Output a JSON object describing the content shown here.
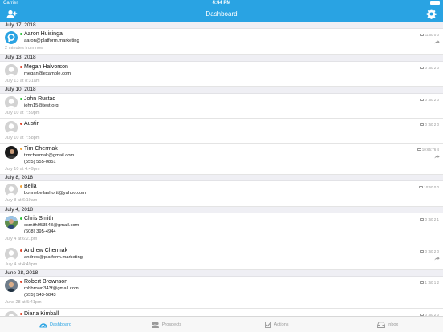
{
  "status_bar": {
    "carrier": "Carrier",
    "time": "4:44 PM",
    "battery_level": 1.0
  },
  "nav": {
    "title": "Dashboard",
    "add_icon": "add-contact-icon",
    "settings_icon": "gear-icon"
  },
  "colors": {
    "accent": "#29a3e3",
    "red_dot": "#e0452b",
    "green_dot": "#2fc23a",
    "orange_dot": "#f0a33a",
    "muted": "#a5a5a5"
  },
  "list": {
    "groups": [
      {
        "date": "July 17, 2018"
      },
      {
        "date": "July 13, 2018"
      },
      {
        "date": "July 10, 2018"
      },
      {
        "date": "July 8, 2018"
      },
      {
        "date": "July 4, 2018"
      },
      {
        "date": "June 28, 2018"
      }
    ],
    "rows": [
      {
        "name": "Aaron Huisinga",
        "status": "green",
        "line1": "aaron@platform.marketing",
        "line2": "",
        "time": "2 minutes from now",
        "stats": "11:60 0 0",
        "shared": true,
        "avatar": "logo"
      },
      {
        "name": "Megan Halvorson",
        "status": "red",
        "line1": "megan@example.com",
        "line2": "",
        "time": "July 13 at 8:31am",
        "stats": "0 :60 2 0",
        "shared": false,
        "avatar": "placeholder"
      },
      {
        "name": "John Rustad",
        "status": "green",
        "line1": "john15@test.org",
        "line2": "",
        "time": "July 10 at 7:59pm",
        "stats": "0 :60 2 0",
        "shared": false,
        "avatar": "placeholder"
      },
      {
        "name": "Austin",
        "status": "red",
        "line1": "",
        "line2": "",
        "time": "July 10 at 7:58pm",
        "stats": "0 :60 2 0",
        "shared": false,
        "avatar": "placeholder"
      },
      {
        "name": "Tim Chermak",
        "status": "orange",
        "line1": "timchermak@gmail.com",
        "line2": "(555) 555-0851",
        "time": "July 10 at 4:49pm",
        "stats": "10:65:76 4",
        "shared": true,
        "avatar": "photo-dark"
      },
      {
        "name": "Bella",
        "status": "orange",
        "line1": "bonnebellashortt@yahoo.com",
        "line2": "",
        "time": "July 8 at 6:19am",
        "stats": "10:60 0 0",
        "shared": false,
        "avatar": "placeholder"
      },
      {
        "name": "Chris Smith",
        "status": "green",
        "line1": "csmith953543@gmail.com",
        "line2": "(608) 395-4944",
        "time": "July 4 at 6:21pm",
        "stats": "0 :60 2 1",
        "shared": false,
        "avatar": "photo-outdoor"
      },
      {
        "name": "Andrew Chermak",
        "status": "red",
        "line1": "andrew@platform.marketing",
        "line2": "",
        "time": "July 4 at 4:49pm",
        "stats": "0 :60 2 0",
        "shared": true,
        "avatar": "placeholder"
      },
      {
        "name": "Robert Brownson",
        "status": "red",
        "line1": "robbrown343f@gmail.com",
        "line2": "(555) 543-5843",
        "time": "June 28 at 5:41pm",
        "stats": "1 :60 1 2",
        "shared": false,
        "avatar": "photo-person"
      },
      {
        "name": "Diana Kimball",
        "status": "red",
        "line1": "",
        "line2": "",
        "time": "",
        "stats": "0 :60 2 0",
        "shared": false,
        "avatar": "placeholder"
      }
    ]
  },
  "tabs": [
    {
      "label": "Dashboard",
      "icon": "dashboard-icon",
      "active": true
    },
    {
      "label": "Prospects",
      "icon": "prospects-icon",
      "active": false
    },
    {
      "label": "Actions",
      "icon": "actions-icon",
      "active": false
    },
    {
      "label": "Inbox",
      "icon": "inbox-icon",
      "active": false
    }
  ]
}
